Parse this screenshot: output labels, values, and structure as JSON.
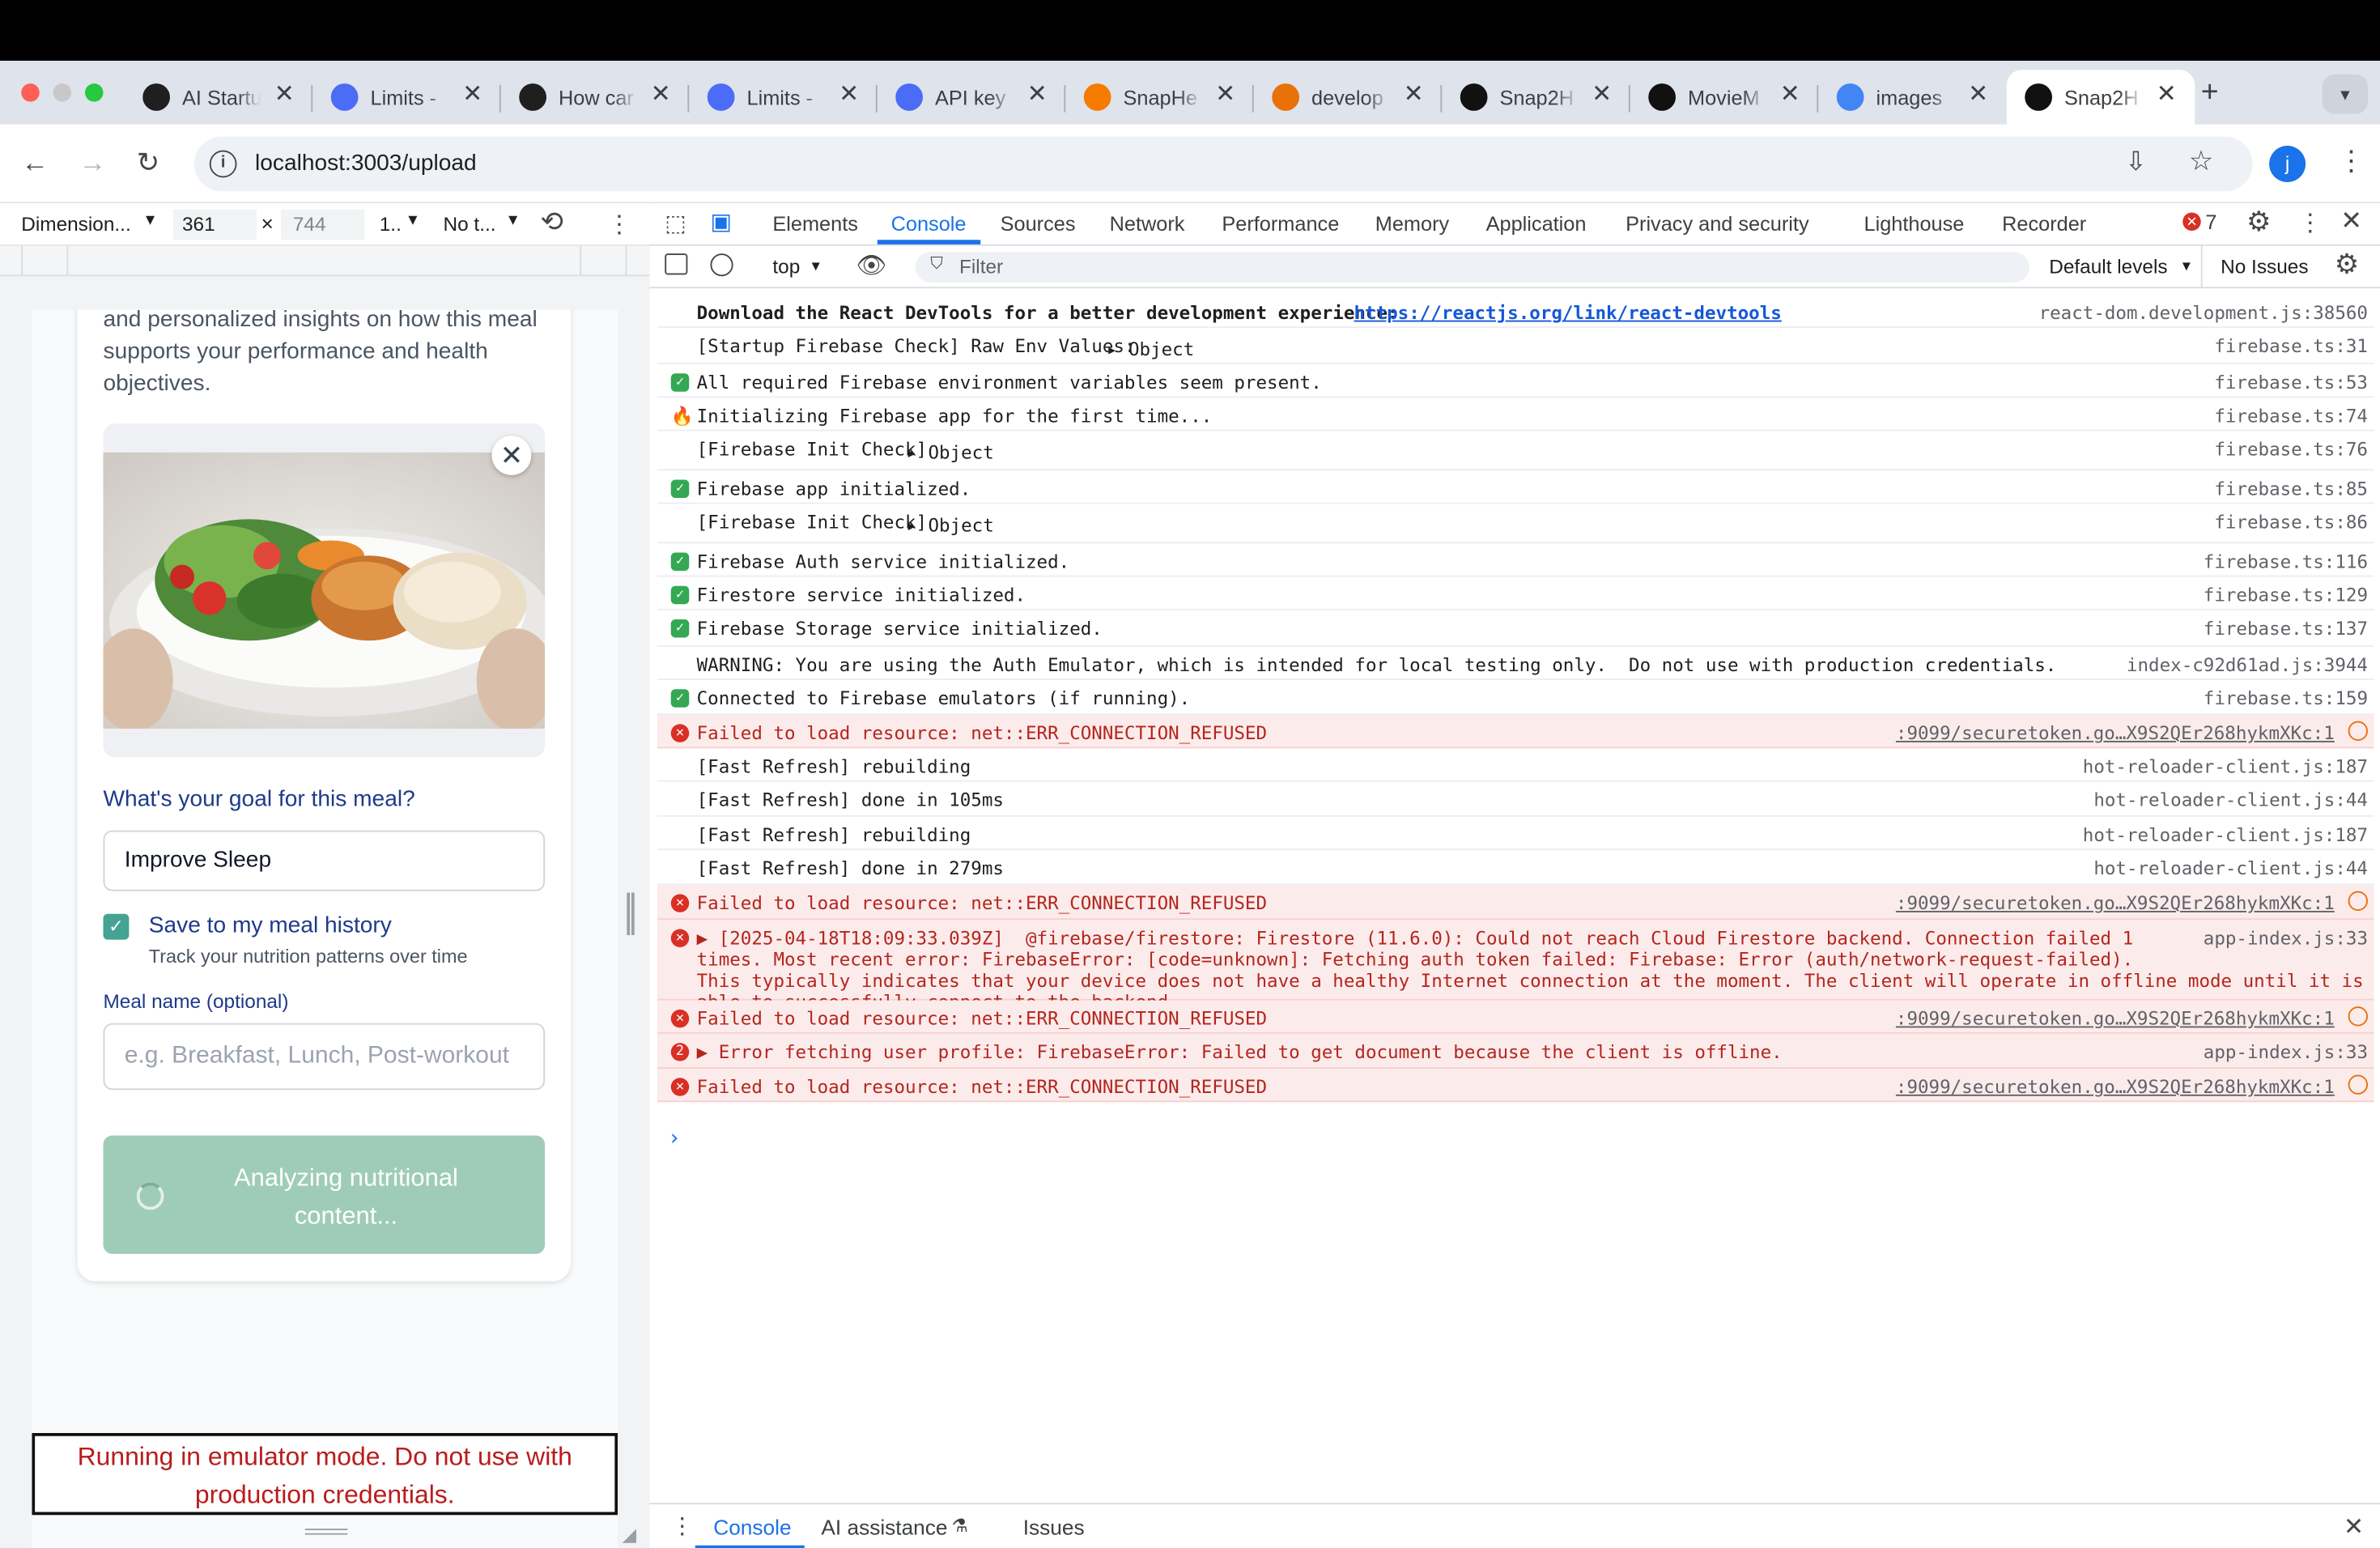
{
  "browser": {
    "tabs": [
      {
        "title": "AI Startu",
        "icon": "openai-icon",
        "color": "#1f1f1f"
      },
      {
        "title": "Limits -",
        "icon": "globe-icon",
        "color": "#4a6cf7"
      },
      {
        "title": "How car",
        "icon": "openai-icon",
        "color": "#1f1f1f"
      },
      {
        "title": "Limits -",
        "icon": "globe-icon",
        "color": "#4a6cf7"
      },
      {
        "title": "API key",
        "icon": "globe-icon",
        "color": "#4a6cf7"
      },
      {
        "title": "SnapHe",
        "icon": "flame-icon",
        "color": "#f57c00"
      },
      {
        "title": "develop",
        "icon": "dots-icon",
        "color": "#e8710a"
      },
      {
        "title": "Snap2H",
        "icon": "heart-icon",
        "color": "#111111"
      },
      {
        "title": "MovieM",
        "icon": "app-icon",
        "color": "#111111"
      },
      {
        "title": "images",
        "icon": "google-icon",
        "color": "#4285f4"
      },
      {
        "title": "Snap2H",
        "icon": "heart-icon",
        "color": "#111111"
      }
    ],
    "new_tab": "+",
    "url": "localhost:3003/upload",
    "avatar_letter": "j"
  },
  "device_toolbar": {
    "dimensions": "Dimension...",
    "width": "361",
    "height": "744",
    "zoom": "1..",
    "throttle": "No t..."
  },
  "app": {
    "intro_text": "and personalized insights on how this meal supports your performance and health objectives.",
    "goal_label": "What's your goal for this meal?",
    "goal_value": "Improve Sleep",
    "save_label": "Save to my meal history",
    "save_hint": "Track your nutrition patterns over time",
    "meal_name_label": "Meal name (optional)",
    "meal_name_placeholder": "e.g. Breakfast, Lunch, Post-workout",
    "analyze_button": "Analyzing nutritional content...",
    "emulator_banner": "Running in emulator mode. Do not use with production credentials."
  },
  "devtools": {
    "tabs": [
      "Elements",
      "Console",
      "Sources",
      "Network",
      "Performance",
      "Memory",
      "Application",
      "Privacy and security",
      "Lighthouse",
      "Recorder"
    ],
    "error_count": "7",
    "context": "top",
    "filter_placeholder": "Filter",
    "levels": "Default levels",
    "issues": "No Issues",
    "drawer_tabs": [
      "Console",
      "AI assistance",
      "Issues"
    ]
  },
  "console": {
    "rows": [
      {
        "type": "info",
        "bold": true,
        "msg": "Download the React DevTools for a better development experience: ",
        "link": "https://reactjs.org/link/react-devtools",
        "src": "react-dom.development.js:38560"
      },
      {
        "type": "log",
        "msg": "[Startup Firebase Check] Raw Env Values: ",
        "obj": "Object",
        "src": "firebase.ts:31"
      },
      {
        "type": "check",
        "msg": "All required Firebase environment variables seem present.",
        "src": "firebase.ts:53"
      },
      {
        "type": "fire",
        "msg": "Initializing Firebase app for the first time...",
        "src": "firebase.ts:74"
      },
      {
        "type": "log",
        "msg": "[Firebase Init Check] ",
        "obj": "Object",
        "src": "firebase.ts:76"
      },
      {
        "type": "check",
        "msg": "Firebase app initialized.",
        "src": "firebase.ts:85"
      },
      {
        "type": "log",
        "msg": "[Firebase Init Check] ",
        "obj": "Object",
        "src": "firebase.ts:86"
      },
      {
        "type": "check",
        "msg": "Firebase Auth service initialized.",
        "src": "firebase.ts:116"
      },
      {
        "type": "check",
        "msg": "Firestore service initialized.",
        "src": "firebase.ts:129"
      },
      {
        "type": "check",
        "msg": "Firebase Storage service initialized.",
        "src": "firebase.ts:137"
      },
      {
        "type": "log",
        "msg": "WARNING: You are using the Auth Emulator, which is intended for local testing only.  Do not use with production credentials.",
        "src": "index-c92d61ad.js:3944"
      },
      {
        "type": "check",
        "msg": "Connected to Firebase emulators (if running).",
        "src": "firebase.ts:159"
      },
      {
        "type": "error",
        "msg": "Failed to load resource: net::ERR_CONNECTION_REFUSED",
        "src": ":9099/securetoken.go…X9S2QEr268hykmXKc:1"
      },
      {
        "type": "log",
        "msg": "[Fast Refresh] rebuilding",
        "src": "hot-reloader-client.js:187"
      },
      {
        "type": "log",
        "msg": "[Fast Refresh] done in 105ms",
        "src": "hot-reloader-client.js:44"
      },
      {
        "type": "log",
        "msg": "[Fast Refresh] rebuilding",
        "src": "hot-reloader-client.js:187"
      },
      {
        "type": "log",
        "msg": "[Fast Refresh] done in 279ms",
        "src": "hot-reloader-client.js:44"
      },
      {
        "type": "error",
        "msg": "Failed to load resource: net::ERR_CONNECTION_REFUSED",
        "src": ":9099/securetoken.go…X9S2QEr268hykmXKc:1"
      },
      {
        "type": "error-multi",
        "msg": "▶ [2025-04-18T18:09:33.039Z]  @firebase/firestore: Firestore (11.6.0): Could not reach Cloud Firestore backend. Connection failed 1\ntimes. Most recent error: FirebaseError: [code=unknown]: Fetching auth token failed: Firebase: Error (auth/network-request-failed).\nThis typically indicates that your device does not have a healthy Internet connection at the moment. The client will operate in offline mode until it is\nable to successfully connect to the backend.",
        "src": "app-index.js:33"
      },
      {
        "type": "error",
        "msg": "Failed to load resource: net::ERR_CONNECTION_REFUSED",
        "src": ":9099/securetoken.go…X9S2QEr268hykmXKc:1"
      },
      {
        "type": "error-count",
        "count": "2",
        "msg": "▶ Error fetching user profile: FirebaseError: Failed to get document because the client is offline.",
        "src": "app-index.js:33"
      },
      {
        "type": "error",
        "msg": "Failed to load resource: net::ERR_CONNECTION_REFUSED",
        "src": ":9099/securetoken.go…X9S2QEr268hykmXKc:1"
      }
    ]
  }
}
